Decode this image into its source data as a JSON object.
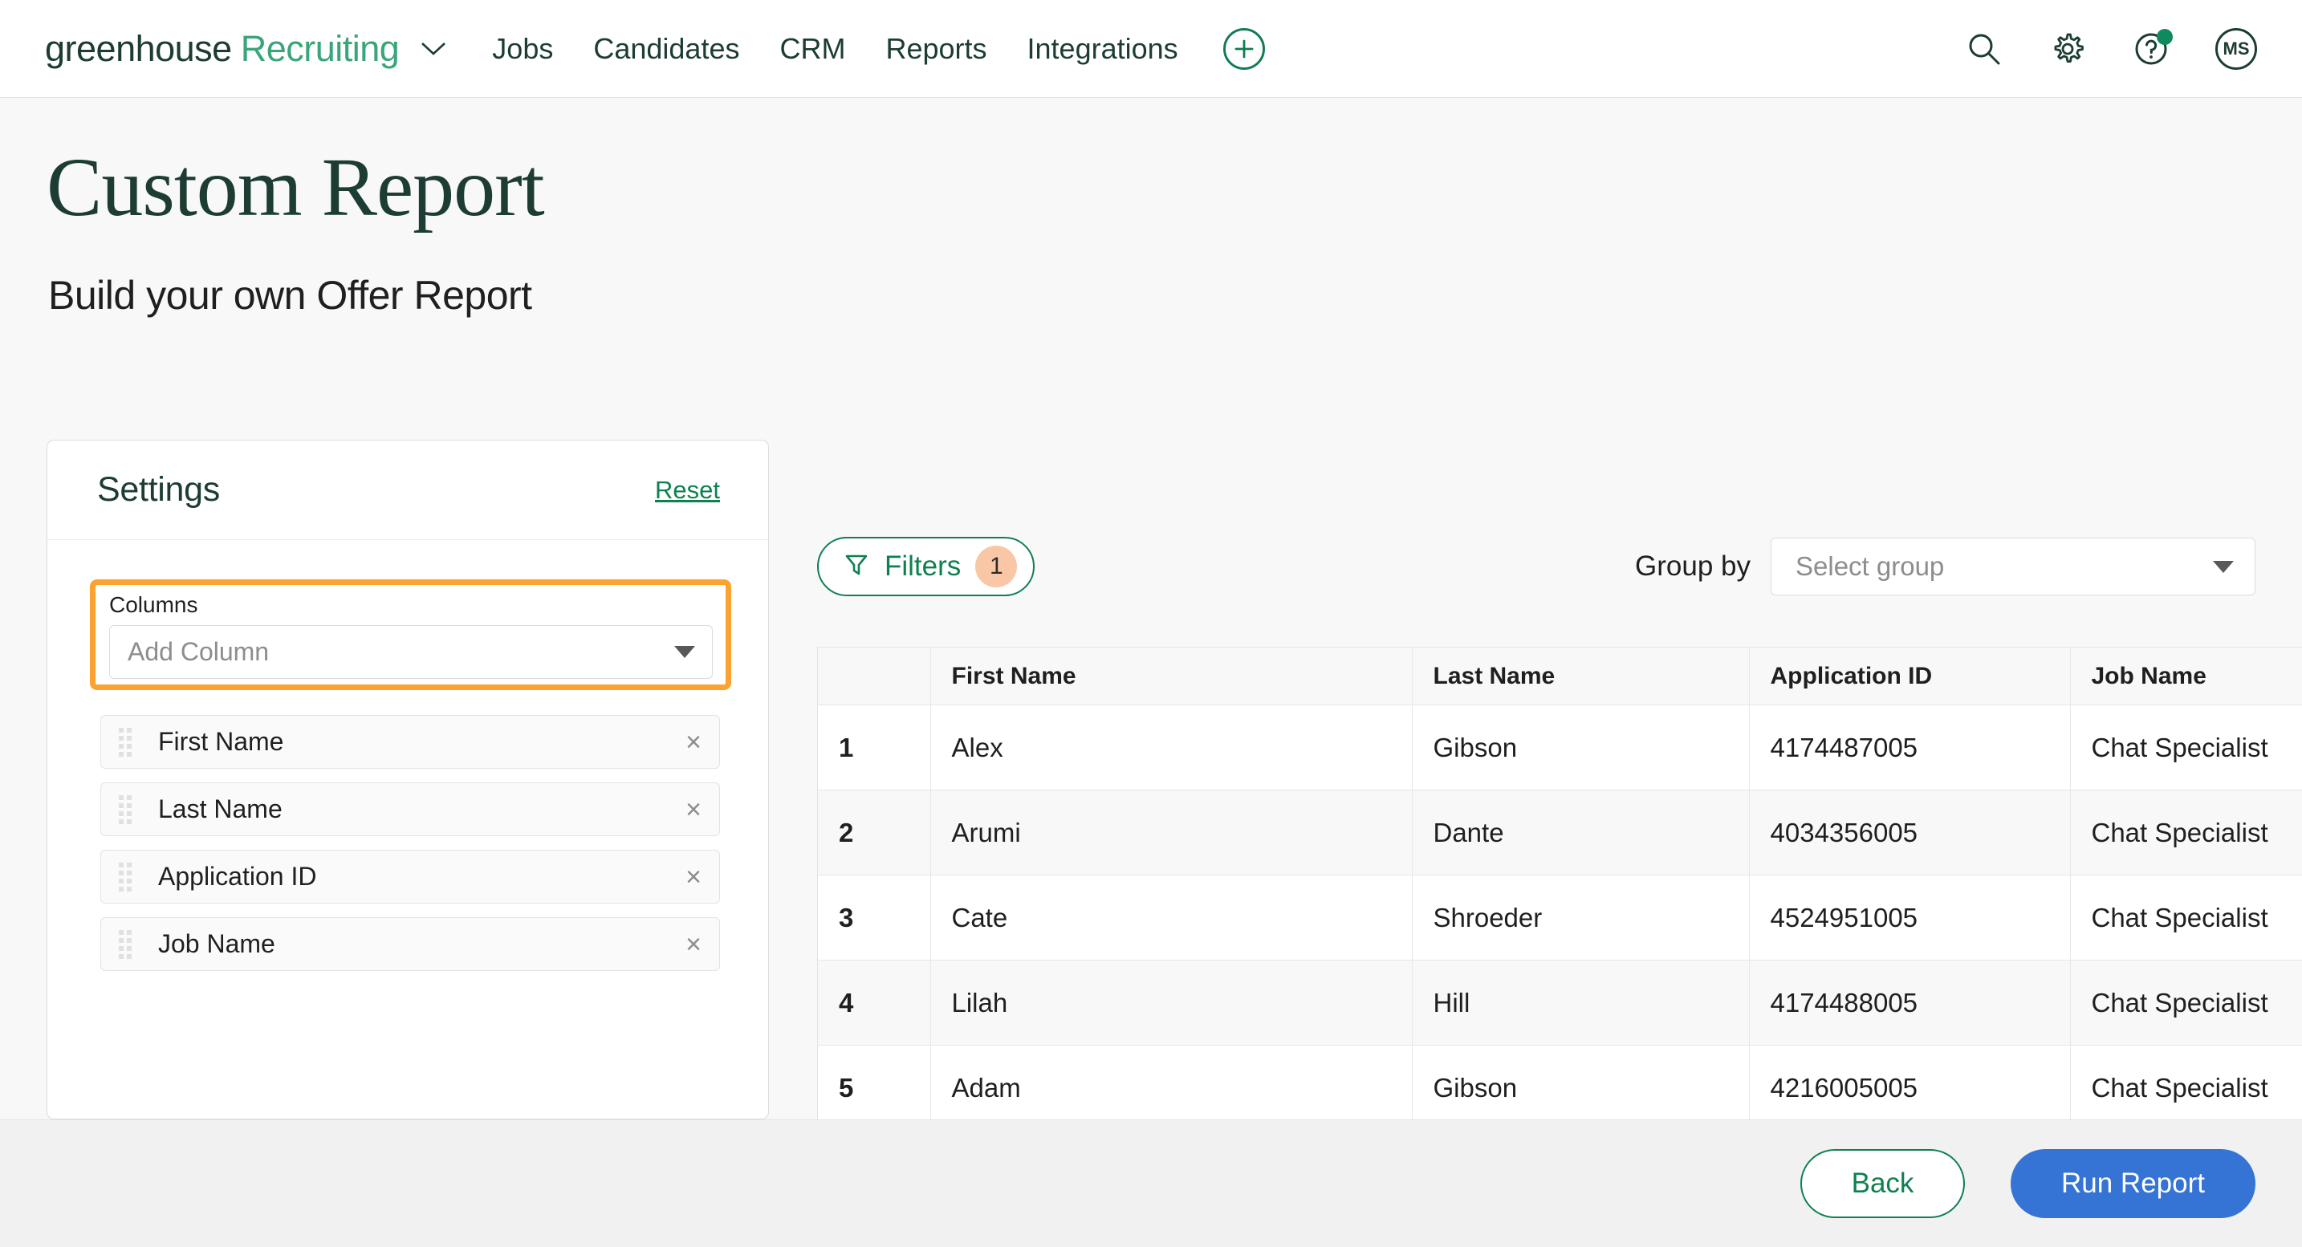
{
  "nav": {
    "brand_primary": "greenhouse",
    "brand_secondary": "Recruiting",
    "links": [
      {
        "label": "Jobs"
      },
      {
        "label": "Candidates"
      },
      {
        "label": "CRM"
      },
      {
        "label": "Reports"
      },
      {
        "label": "Integrations"
      }
    ],
    "add_icon": "plus-circle-icon",
    "search_icon": "search-icon",
    "settings_icon": "gear-icon",
    "help_icon": "help-circle-icon",
    "avatar_initials": "MS"
  },
  "header": {
    "title": "Custom Report",
    "subtitle": "Build your own Offer Report"
  },
  "settings": {
    "title": "Settings",
    "reset_label": "Reset",
    "columns_label": "Columns",
    "add_column_placeholder": "Add Column",
    "highlight_color": "#fca22e",
    "columns": [
      {
        "label": "First Name",
        "remove_label": "×"
      },
      {
        "label": "Last Name",
        "remove_label": "×"
      },
      {
        "label": "Application ID",
        "remove_label": "×"
      },
      {
        "label": "Job Name",
        "remove_label": "×"
      }
    ]
  },
  "toolbar": {
    "filters_label": "Filters",
    "filters_count": "1",
    "filters_badge_color": "#f9c7a6",
    "group_by_label": "Group by",
    "group_by_placeholder": "Select group"
  },
  "table": {
    "columns": [
      "",
      "First Name",
      "Last Name",
      "Application ID",
      "Job Name"
    ],
    "rows": [
      {
        "idx": "1",
        "first_name": "Alex",
        "last_name": "Gibson",
        "application_id": "4174487005",
        "job_name": "Chat Specialist"
      },
      {
        "idx": "2",
        "first_name": "Arumi",
        "last_name": "Dante",
        "application_id": "4034356005",
        "job_name": "Chat Specialist"
      },
      {
        "idx": "3",
        "first_name": "Cate",
        "last_name": "Shroeder",
        "application_id": "4524951005",
        "job_name": "Chat Specialist"
      },
      {
        "idx": "4",
        "first_name": "Lilah",
        "last_name": "Hill",
        "application_id": "4174488005",
        "job_name": "Chat Specialist"
      },
      {
        "idx": "5",
        "first_name": "Adam",
        "last_name": "Gibson",
        "application_id": "4216005005",
        "job_name": "Chat Specialist"
      }
    ]
  },
  "footer": {
    "back_label": "Back",
    "run_label": "Run Report",
    "run_color": "#3574d4"
  }
}
